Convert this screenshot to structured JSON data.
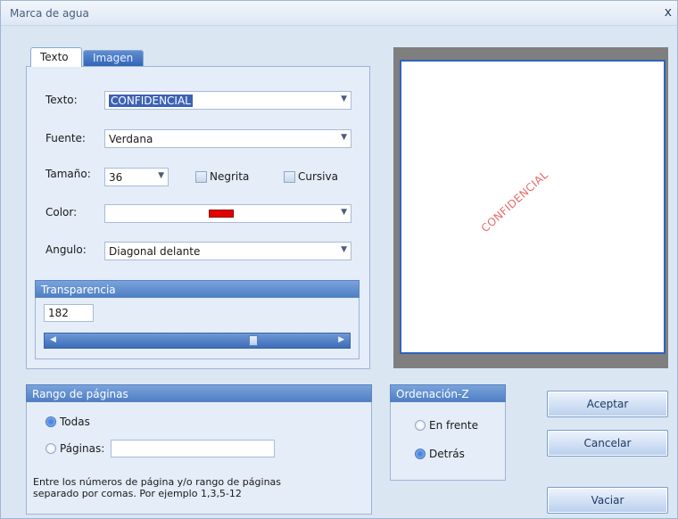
{
  "window": {
    "title": "Marca de agua",
    "close_glyph": "x"
  },
  "tabs": [
    {
      "label": "Texto",
      "active": true
    },
    {
      "label": "Imagen",
      "active": false
    }
  ],
  "texto_tab": {
    "texto_label": "Texto:",
    "texto_value": "CONFIDENCIAL",
    "fuente_label": "Fuente:",
    "fuente_value": "Verdana",
    "tamano_label": "Tamaño:",
    "tamano_value": "36",
    "negrita_label": "Negrita",
    "cursiva_label": "Cursiva",
    "color_label": "Color:",
    "color_value_hex": "#e30000",
    "angulo_label": "Angulo:",
    "angulo_value": "Diagonal delante",
    "transparencia_header": "Transparencia",
    "transparencia_value": "182",
    "transparencia_level_fraction": 0.71
  },
  "preview": {
    "watermark_text": "CONFIDENCIAL",
    "watermark_color": "#e86a6a"
  },
  "rango": {
    "header": "Rango de páginas",
    "todas_label": "Todas",
    "paginas_label": "Páginas:",
    "paginas_value": "",
    "selected": "todas",
    "help_line1": "Entre los números de página y/o rango de páginas",
    "help_line2": "separado por comas. Por ejemplo 1,3,5-12"
  },
  "ordenacion": {
    "header": "Ordenación-Z",
    "en_frente_label": "En frente",
    "detras_label": "Detrás",
    "selected": "detras"
  },
  "buttons": {
    "aceptar": "Aceptar",
    "cancelar": "Cancelar",
    "vaciar": "Vaciar"
  },
  "colors": {
    "accent": "#3b62b3",
    "header_blue": "#5f8ed0",
    "dialog_bg": "#dbe6f3"
  }
}
